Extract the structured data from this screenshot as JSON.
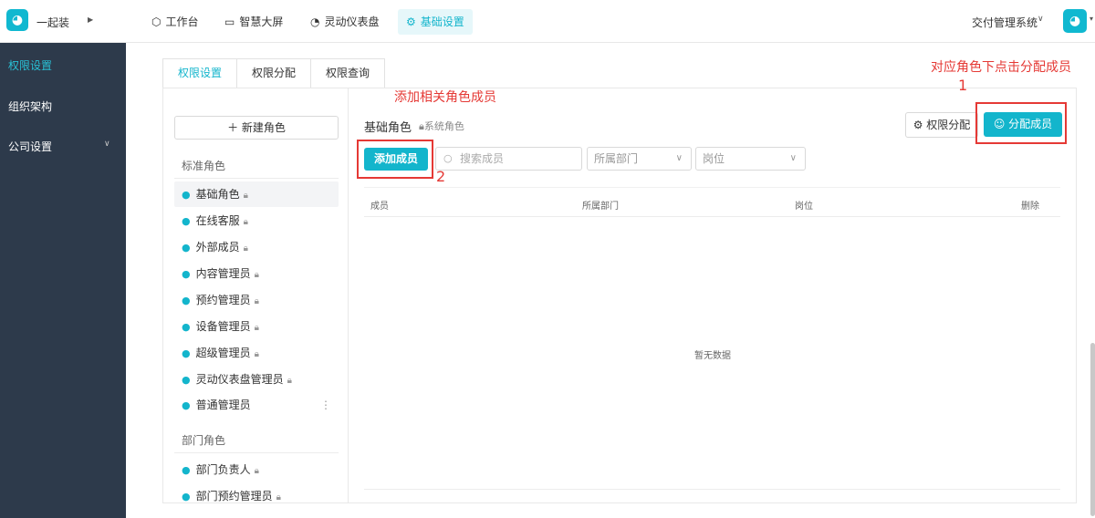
{
  "topbar": {
    "app_name": "一起装",
    "nav": [
      {
        "label": "工作台",
        "icon": "cube-icon"
      },
      {
        "label": "智慧大屏",
        "icon": "monitor-icon"
      },
      {
        "label": "灵动仪表盘",
        "icon": "gauge-icon"
      },
      {
        "label": "基础设置",
        "icon": "gear-icon",
        "active": true
      }
    ],
    "system_name": "交付管理系统"
  },
  "sidebar": {
    "items": [
      {
        "label": "权限设置",
        "active": true
      },
      {
        "label": "组织架构"
      },
      {
        "label": "公司设置",
        "has_submenu": true
      }
    ]
  },
  "tabs": [
    {
      "label": "权限设置",
      "active": true
    },
    {
      "label": "权限分配"
    },
    {
      "label": "权限查询"
    }
  ],
  "roles_panel": {
    "new_role_label": "新建角色",
    "standard_title": "标准角色",
    "standard_roles": [
      {
        "label": "基础角色",
        "locked": true,
        "active": true
      },
      {
        "label": "在线客服",
        "locked": true
      },
      {
        "label": "外部成员",
        "locked": true
      },
      {
        "label": "内容管理员",
        "locked": true
      },
      {
        "label": "预约管理员",
        "locked": true
      },
      {
        "label": "设备管理员",
        "locked": true
      },
      {
        "label": "超级管理员",
        "locked": true
      },
      {
        "label": "灵动仪表盘管理员",
        "locked": true
      },
      {
        "label": "普通管理员",
        "locked": false,
        "has_more": true
      }
    ],
    "department_title": "部门角色",
    "department_roles": [
      {
        "label": "部门负责人",
        "locked": true
      },
      {
        "label": "部门预约管理员",
        "locked": true
      }
    ]
  },
  "detail": {
    "role_title": "基础角色",
    "role_subtitle": "系统角色",
    "perm_button": "权限分配",
    "assign_button": "分配成员",
    "add_member_button": "添加成员",
    "search_placeholder": "搜索成员",
    "dept_select": "所属部门",
    "position_select": "岗位",
    "columns": [
      "成员",
      "所属部门",
      "岗位",
      "删除"
    ],
    "empty_text": "暂无数据"
  },
  "annotations": {
    "top_right_text": "对应角色下点击分配成员",
    "top_right_num": "1",
    "add_text": "添加相关角色成员",
    "add_num": "2",
    "color": "#e53935"
  },
  "colors": {
    "accent": "#13b5cc",
    "sidebar_bg": "#2d3a4b",
    "sidebar_active": "#29c1d6"
  }
}
